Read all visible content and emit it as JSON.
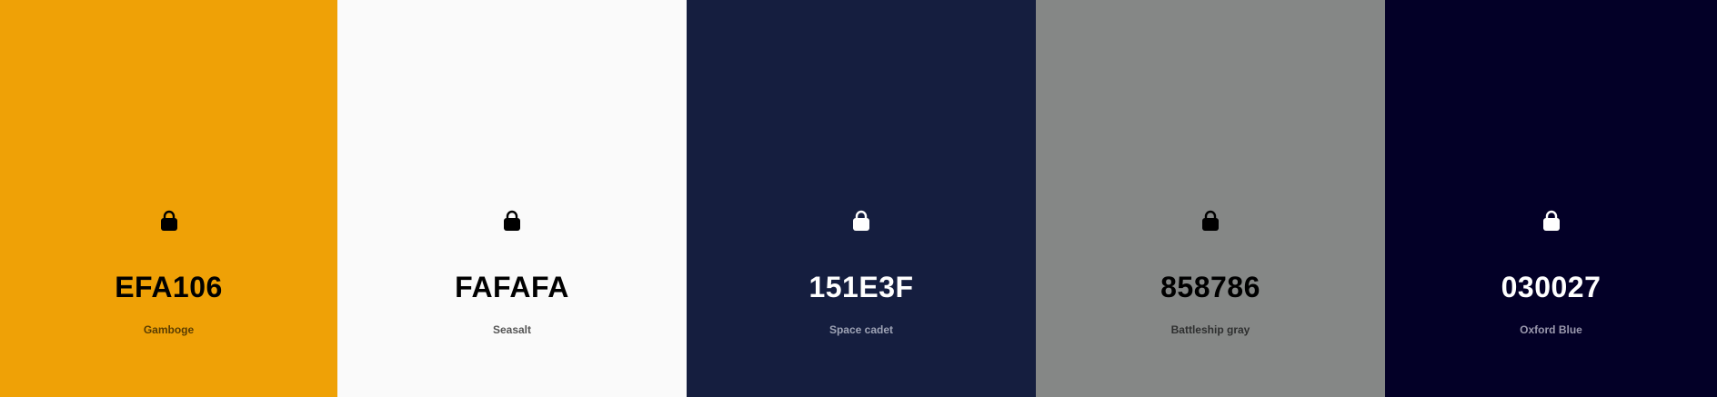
{
  "palette": {
    "swatches": [
      {
        "hex": "EFA106",
        "name": "Gamboge",
        "bg": "#EFA106",
        "fg": "#000000",
        "name_color": "#5a3d02",
        "icon": "lock-icon"
      },
      {
        "hex": "FAFAFA",
        "name": "Seasalt",
        "bg": "#FAFAFA",
        "fg": "#000000",
        "name_color": "#555555",
        "icon": "lock-icon"
      },
      {
        "hex": "151E3F",
        "name": "Space cadet",
        "bg": "#151E3F",
        "fg": "#FFFFFF",
        "name_color": "#9ea3b5",
        "icon": "lock-icon"
      },
      {
        "hex": "858786",
        "name": "Battleship gray",
        "bg": "#858786",
        "fg": "#000000",
        "name_color": "#2e2f2f",
        "icon": "lock-icon"
      },
      {
        "hex": "030027",
        "name": "Oxford Blue",
        "bg": "#030027",
        "fg": "#FFFFFF",
        "name_color": "#9a98ad",
        "icon": "lock-icon"
      }
    ]
  }
}
